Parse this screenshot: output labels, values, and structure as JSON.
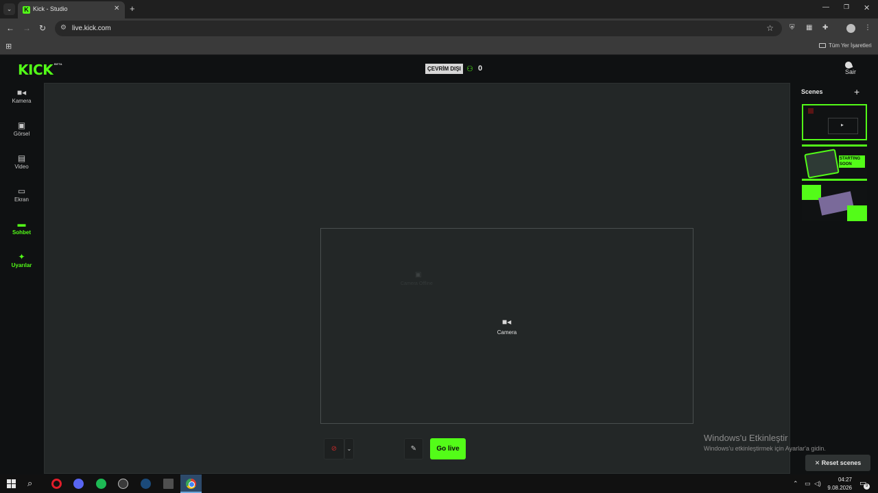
{
  "browser": {
    "tab_title": "Kick - Studio",
    "url": "live.kick.com",
    "bookmarks_label": "Tüm Yer İşaretleri"
  },
  "header": {
    "logo_text": "KICK",
    "logo_badge": "BETA",
    "status": "ÇEVRİM DIŞI",
    "viewer_count": "0",
    "user_label": "Sair"
  },
  "sidebar": {
    "items": [
      {
        "label": "Kamera",
        "icon": "camera-icon"
      },
      {
        "label": "Görsel",
        "icon": "image-icon"
      },
      {
        "label": "Video",
        "icon": "film-icon"
      },
      {
        "label": "Ekran",
        "icon": "screen-icon"
      },
      {
        "label": "Sohbet",
        "icon": "chat-icon"
      },
      {
        "label": "Uyarılar",
        "icon": "party-icon"
      }
    ]
  },
  "canvas": {
    "source_label": "Camera",
    "ghost_label": "Camera Offline"
  },
  "controls": {
    "go_live": "Go live"
  },
  "scenes": {
    "title": "Scenes",
    "scene2_text": "STARTING SOON"
  },
  "watermark": {
    "line1": "Windows'u Etkinleştir",
    "line2": "Windows'u etkinleştirmek için Ayarlar'a gidin."
  },
  "reset_scenes": "Reset scenes",
  "taskbar": {
    "time": "04:27",
    "date": "9.08.2026",
    "notification_count": "9"
  },
  "colors": {
    "brand": "#53fc18",
    "canvas_bg": "#232727",
    "app_bg": "#0f1112"
  }
}
